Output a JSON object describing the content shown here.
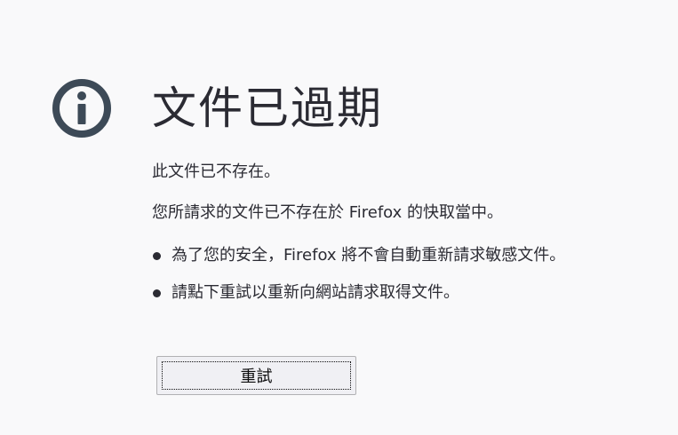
{
  "page": {
    "title": "文件已過期",
    "short_description": "此文件已不存在。",
    "long_description": "您所請求的文件已不存在於 Firefox 的快取當中。",
    "bullets": [
      "為了您的安全，Firefox 將不會自動重新請求敏感文件。",
      "請點下重試以重新向網站請求取得文件。"
    ],
    "retry_label": "重試",
    "icon": "info-icon"
  },
  "colors": {
    "background": "#f9f9fa",
    "text": "#2b2b33",
    "icon": "#3d4a57"
  }
}
